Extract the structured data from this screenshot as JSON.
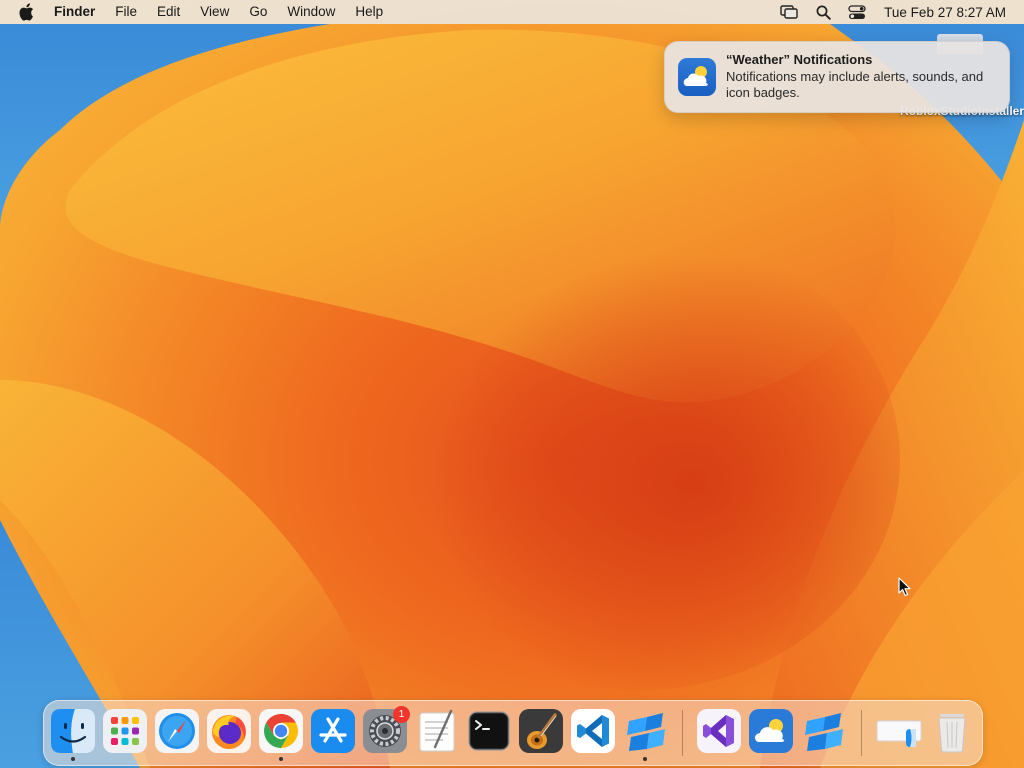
{
  "menubar": {
    "app_name": "Finder",
    "menus": [
      "File",
      "Edit",
      "View",
      "Go",
      "Window",
      "Help"
    ],
    "status_icons": [
      "screen-mirroring-icon",
      "spotlight-search-icon",
      "control-center-icon"
    ],
    "clock": "Tue Feb 27  8:27 AM"
  },
  "notification": {
    "app": "Weather",
    "title": "“Weather” Notifications",
    "body": "Notifications may include alerts, sounds, and icon badges."
  },
  "desktop": {
    "file_label": "RobloxStudioInstaller"
  },
  "dock": {
    "apps": [
      {
        "name": "Finder",
        "icon": "finder-icon",
        "running": true
      },
      {
        "name": "Launchpad",
        "icon": "launchpad-icon",
        "running": false
      },
      {
        "name": "Safari",
        "icon": "safari-icon",
        "running": false
      },
      {
        "name": "Firefox",
        "icon": "firefox-icon",
        "running": false
      },
      {
        "name": "Google Chrome",
        "icon": "chrome-icon",
        "running": true
      },
      {
        "name": "App Store",
        "icon": "app-store-icon",
        "running": false
      },
      {
        "name": "System Settings",
        "icon": "system-settings-icon",
        "running": false,
        "badge": "1"
      },
      {
        "name": "TextEdit",
        "icon": "textedit-icon",
        "running": false
      },
      {
        "name": "Terminal",
        "icon": "terminal-icon",
        "running": false
      },
      {
        "name": "GarageBand",
        "icon": "garageband-icon",
        "running": false
      },
      {
        "name": "Visual Studio Code",
        "icon": "vscode-icon",
        "running": false
      },
      {
        "name": "Roblox Studio",
        "icon": "roblox-studio-icon",
        "running": true
      },
      {
        "name": "Visual Studio",
        "icon": "visual-studio-icon",
        "running": false
      },
      {
        "name": "Weather",
        "icon": "weather-icon",
        "running": false
      },
      {
        "name": "Roblox Studio",
        "icon": "roblox-studio-icon",
        "running": false
      },
      {
        "name": "Downloads",
        "icon": "downloads-stack-icon",
        "running": false
      },
      {
        "name": "Trash",
        "icon": "trash-icon",
        "running": false
      }
    ]
  },
  "colors": {
    "wallpaper_orange": "#f48a28",
    "wallpaper_blue": "#3f8fd6",
    "badge_red": "#f2352c",
    "notification_bg": "#e8e4e2"
  }
}
